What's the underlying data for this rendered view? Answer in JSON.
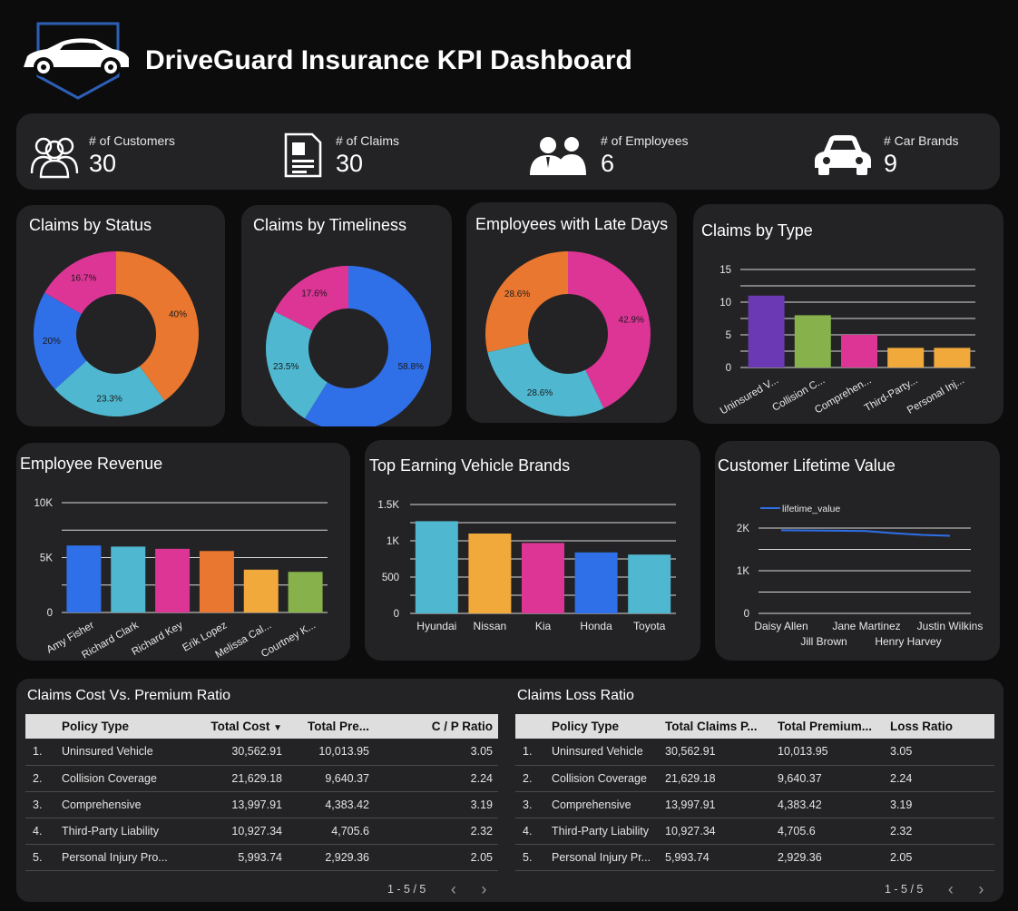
{
  "header": {
    "title": "DriveGuard Insurance KPI Dashboard"
  },
  "kpis": [
    {
      "label": "# of Customers",
      "value": "30",
      "icon": "users-icon"
    },
    {
      "label": "# of Claims",
      "value": "30",
      "icon": "document-icon"
    },
    {
      "label": "# of Employees",
      "value": "6",
      "icon": "employees-icon"
    },
    {
      "label": "# Car Brands",
      "value": "9",
      "icon": "car-icon"
    }
  ],
  "colors": {
    "card": "#232325",
    "blue": "#2f6fe8",
    "teal": "#4fb8d0",
    "pink": "#dc3596",
    "orange": "#ea772f",
    "purple": "#6a39b3",
    "green": "#86b14b",
    "yellow": "#f2a93b"
  },
  "chart_data": [
    {
      "id": "status",
      "type": "pie",
      "title": "Claims by Status",
      "slices": [
        {
          "label": "40%",
          "value": 40,
          "color": "#ea772f"
        },
        {
          "label": "23.3%",
          "value": 23.3,
          "color": "#4fb8d0"
        },
        {
          "label": "20%",
          "value": 20,
          "color": "#2f6fe8"
        },
        {
          "label": "16.7%",
          "value": 16.7,
          "color": "#dc3596"
        }
      ]
    },
    {
      "id": "timeliness",
      "type": "pie",
      "title": "Claims by Timeliness",
      "slices": [
        {
          "label": "58.8%",
          "value": 58.8,
          "color": "#2f6fe8"
        },
        {
          "label": "23.5%",
          "value": 23.5,
          "color": "#4fb8d0"
        },
        {
          "label": "17.6%",
          "value": 17.6,
          "color": "#dc3596"
        }
      ]
    },
    {
      "id": "late",
      "type": "pie",
      "title": "Employees with Late Days",
      "slices": [
        {
          "label": "42.9%",
          "value": 42.9,
          "color": "#dc3596"
        },
        {
          "label": "28.6%",
          "value": 28.6,
          "color": "#4fb8d0"
        },
        {
          "label": "28.6%",
          "value": 28.6,
          "color": "#ea772f"
        }
      ]
    },
    {
      "id": "type",
      "type": "bar",
      "title": "Claims by Type",
      "categories": [
        "Uninsured V...",
        "Collision C...",
        "Comprehen...",
        "Third-Party...",
        "Personal Inj..."
      ],
      "values": [
        11,
        8,
        5,
        3,
        3
      ],
      "colors": [
        "#6a39b3",
        "#86b14b",
        "#dc3596",
        "#f2a93b",
        "#f2a93b"
      ],
      "ylim": [
        0,
        15
      ],
      "yticks": [
        0,
        5,
        10,
        15
      ],
      "ytick_labels": [
        "0",
        "5",
        "10",
        "15"
      ],
      "rotated_labels": true
    },
    {
      "id": "revenue",
      "type": "bar",
      "title": "Employee Revenue",
      "categories": [
        "Amy Fisher",
        "Richard Clark",
        "Richard Key",
        "Erik Lopez",
        "Melissa Cal...",
        "Courtney K..."
      ],
      "values": [
        6100,
        6000,
        5800,
        5600,
        3900,
        3700
      ],
      "colors": [
        "#2f6fe8",
        "#4fb8d0",
        "#dc3596",
        "#ea772f",
        "#f2a93b",
        "#86b14b"
      ],
      "ylim": [
        0,
        10000
      ],
      "yticks": [
        0,
        5000,
        10000
      ],
      "ytick_labels": [
        "0",
        "5K",
        "10K"
      ],
      "rotated_labels": true
    },
    {
      "id": "brands",
      "type": "bar",
      "title": "Top Earning Vehicle Brands",
      "categories": [
        "Hyundai",
        "Nissan",
        "Kia",
        "Honda",
        "Toyota"
      ],
      "values": [
        1270,
        1100,
        970,
        840,
        810
      ],
      "colors": [
        "#4fb8d0",
        "#f2a93b",
        "#dc3596",
        "#2f6fe8",
        "#4fb8d0"
      ],
      "ylim": [
        0,
        1500
      ],
      "yticks": [
        0,
        500,
        1000,
        1500
      ],
      "ytick_labels": [
        "0",
        "500",
        "1K",
        "1.5K"
      ],
      "rotated_labels": false
    },
    {
      "id": "clv",
      "type": "line",
      "title": "Customer Lifetime Value",
      "series": [
        {
          "name": "lifetime_value",
          "color": "#2f6fe8",
          "values": [
            1950,
            1945,
            1940,
            1930,
            1880,
            1840,
            1820
          ]
        }
      ],
      "x": [
        0,
        1,
        2,
        3,
        4,
        5,
        6
      ],
      "ylim": [
        0,
        2000
      ],
      "yticks": [
        0,
        1000,
        2000
      ],
      "ytick_labels": [
        "0",
        "1K",
        "2K"
      ],
      "xtick_labels_row1": [
        "Daisy Allen",
        "Jane Martinez",
        "Justin Wilkins"
      ],
      "xtick_labels_row2": [
        "Jill Brown",
        "Henry Harvey"
      ]
    }
  ],
  "tables": {
    "cost_premium": {
      "title": "Claims Cost Vs. Premium Ratio",
      "columns": [
        "Policy Type",
        "Total Cost",
        "Total Pre...",
        "C / P Ratio"
      ],
      "sort_icon": "▼",
      "rows": [
        [
          "1.",
          "Uninsured Vehicle",
          "30,562.91",
          "10,013.95",
          "3.05"
        ],
        [
          "2.",
          "Collision Coverage",
          "21,629.18",
          "9,640.37",
          "2.24"
        ],
        [
          "3.",
          "Comprehensive",
          "13,997.91",
          "4,383.42",
          "3.19"
        ],
        [
          "4.",
          "Third-Party Liability",
          "10,927.34",
          "4,705.6",
          "2.32"
        ],
        [
          "5.",
          "Personal Injury Pro...",
          "5,993.74",
          "2,929.36",
          "2.05"
        ]
      ],
      "pager": "1 - 5 / 5"
    },
    "loss_ratio": {
      "title": "Claims Loss Ratio",
      "columns": [
        "Policy Type",
        "Total Claims P...",
        "Total Premium...",
        "Loss Ratio"
      ],
      "rows": [
        [
          "1.",
          "Uninsured Vehicle",
          "30,562.91",
          "10,013.95",
          "3.05"
        ],
        [
          "2.",
          "Collision Coverage",
          "21,629.18",
          "9,640.37",
          "2.24"
        ],
        [
          "3.",
          "Comprehensive",
          "13,997.91",
          "4,383.42",
          "3.19"
        ],
        [
          "4.",
          "Third-Party Liability",
          "10,927.34",
          "4,705.6",
          "2.32"
        ],
        [
          "5.",
          "Personal Injury Pr...",
          "5,993.74",
          "2,929.36",
          "2.05"
        ]
      ],
      "pager": "1 - 5 / 5"
    }
  }
}
